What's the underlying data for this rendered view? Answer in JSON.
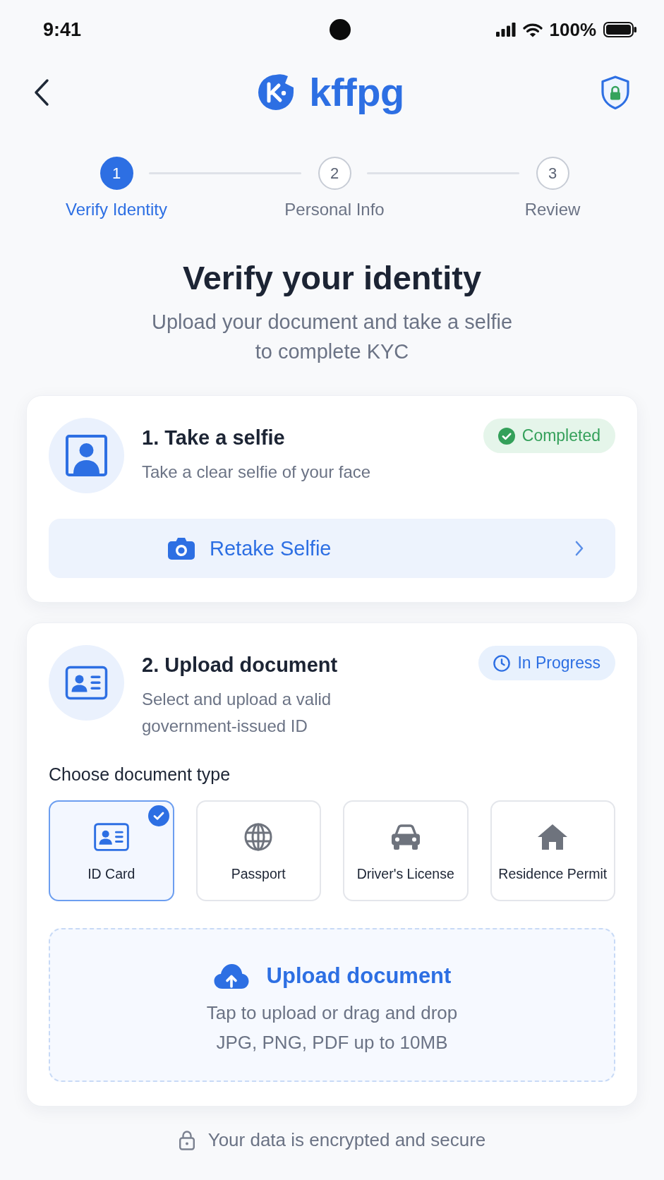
{
  "status_bar": {
    "time": "9:41",
    "battery": "100%"
  },
  "header": {
    "logo_text": "kffpg"
  },
  "stepper": [
    {
      "number": "1",
      "label": "Verify Identity",
      "selected": true
    },
    {
      "number": "2",
      "label": "Personal Info",
      "selected": false
    },
    {
      "number": "3",
      "label": "Review",
      "selected": false
    }
  ],
  "title": "Verify your identity",
  "subtitle": "Upload your document and take a selfie\nto complete KYC",
  "selfie_step": {
    "title": "1. Take a selfie",
    "description": "Take a clear selfie of your face",
    "status": {
      "kind": "completed",
      "label": "Completed"
    },
    "retake_button": "Retake Selfie"
  },
  "document_step": {
    "title": "2. Upload document",
    "description": "Select and upload a valid\ngovernment-issued ID",
    "status": {
      "kind": "in_progress",
      "label": "In Progress"
    },
    "choose_label": "Choose document type",
    "document_types": [
      {
        "kind": "id_card",
        "label": "ID Card",
        "selected": true
      },
      {
        "kind": "passport",
        "label": "Passport",
        "selected": false
      },
      {
        "kind": "drivers_license",
        "label": "Driver's License",
        "selected": false
      },
      {
        "kind": "residence_permit",
        "label": "Residence Permit",
        "selected": false
      }
    ],
    "upload": {
      "title": "Upload document",
      "hint": "Tap to upload or drag and drop",
      "formats": "JPG, PNG, PDF up to 10MB"
    }
  },
  "security_note": "Your data is encrypted and secure"
}
